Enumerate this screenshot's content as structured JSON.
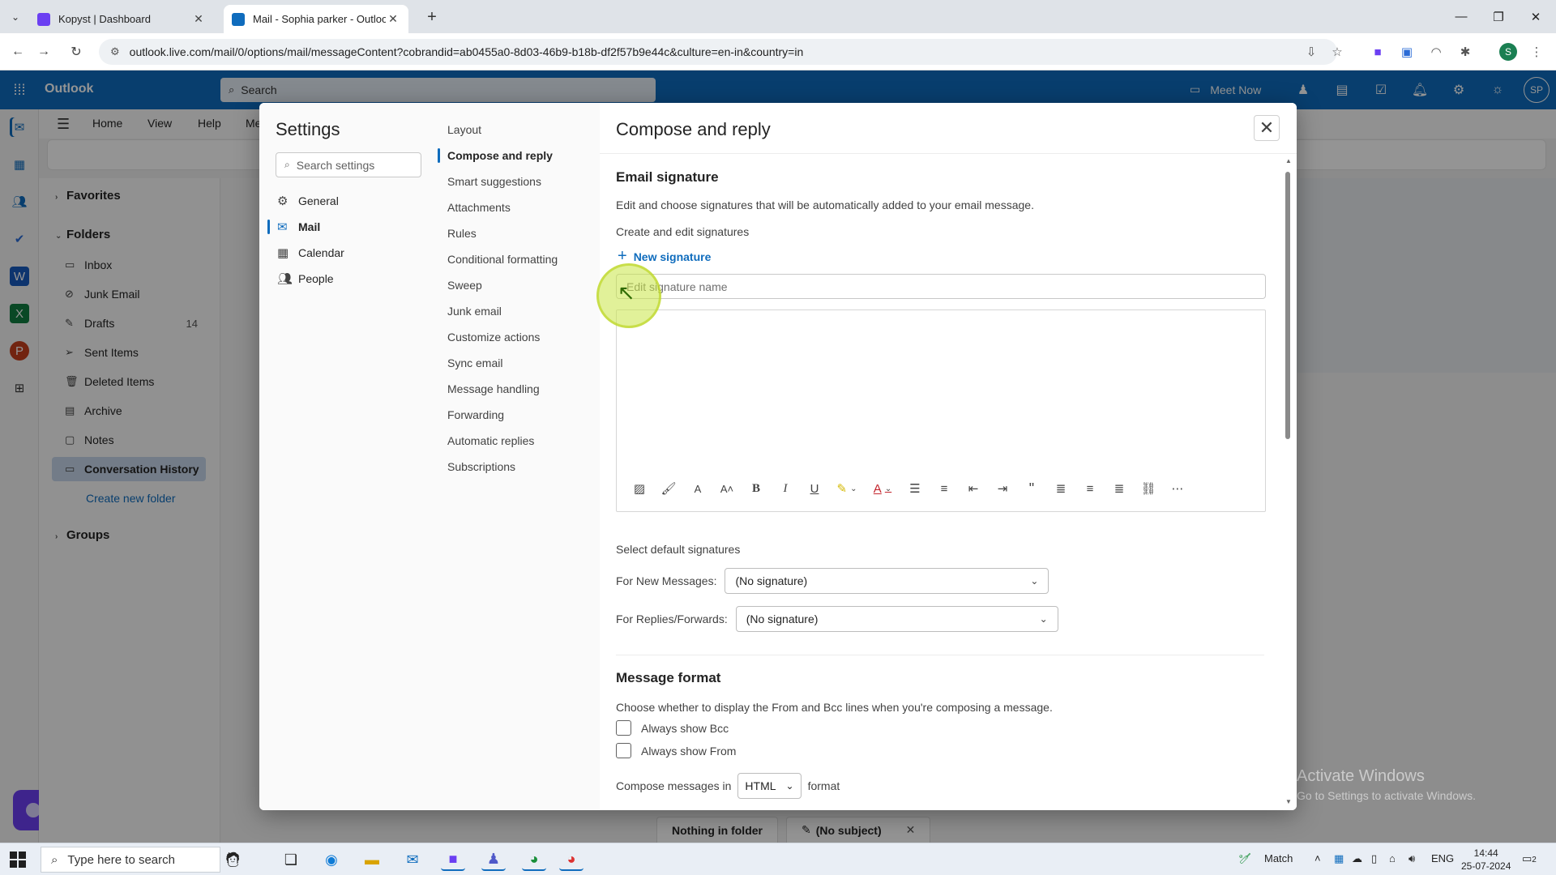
{
  "browser": {
    "tabs": [
      {
        "title": "Kopyst | Dashboard",
        "active": false
      },
      {
        "title": "Mail - Sophia parker - Outlook",
        "active": true
      }
    ],
    "url": "outlook.live.com/mail/0/options/mail/messageContent?cobrandid=ab0455a0-8d03-46b9-b18b-df2f57b9e44c&culture=en-in&country=in",
    "profile_initial": "S"
  },
  "outlook": {
    "brand": "Outlook",
    "search_placeholder": "Search",
    "meet_now": "Meet Now",
    "avatar_initials": "SP",
    "ribbon_tabs": [
      "Home",
      "View",
      "Help",
      "Me"
    ],
    "folders": {
      "favorites_label": "Favorites",
      "folders_label": "Folders",
      "groups_label": "Groups",
      "items": [
        {
          "label": "Inbox",
          "icon": "inbox-icon",
          "count": ""
        },
        {
          "label": "Junk Email",
          "icon": "junk-icon",
          "count": ""
        },
        {
          "label": "Drafts",
          "icon": "pencil-icon",
          "count": "14"
        },
        {
          "label": "Sent Items",
          "icon": "send-icon",
          "count": ""
        },
        {
          "label": "Deleted Items",
          "icon": "trash-icon",
          "count": ""
        },
        {
          "label": "Archive",
          "icon": "archive-icon",
          "count": ""
        },
        {
          "label": "Notes",
          "icon": "note-icon",
          "count": ""
        },
        {
          "label": "Conversation History",
          "icon": "folder-icon",
          "count": ""
        }
      ],
      "create_new_folder": "Create new folder"
    },
    "bottom_tabs": [
      "Nothing in folder",
      "(No subject)"
    ]
  },
  "settings": {
    "title": "Settings",
    "search_placeholder": "Search settings",
    "categories": [
      {
        "label": "General",
        "icon": "gear-icon"
      },
      {
        "label": "Mail",
        "icon": "mail-icon"
      },
      {
        "label": "Calendar",
        "icon": "calendar-icon"
      },
      {
        "label": "People",
        "icon": "people-icon"
      }
    ],
    "selected_category": "Mail",
    "subcategories": [
      "Layout",
      "Compose and reply",
      "Smart suggestions",
      "Attachments",
      "Rules",
      "Conditional formatting",
      "Sweep",
      "Junk email",
      "Customize actions",
      "Sync email",
      "Message handling",
      "Forwarding",
      "Automatic replies",
      "Subscriptions"
    ],
    "selected_subcategory": "Compose and reply"
  },
  "compose": {
    "title": "Compose and reply",
    "email_signature": {
      "heading": "Email signature",
      "description": "Edit and choose signatures that will be automatically added to your email message.",
      "create_edit": "Create and edit signatures",
      "new_signature": "New signature",
      "name_placeholder": "Edit signature name"
    },
    "defaults": {
      "heading": "Select default signatures",
      "new_messages_label": "For New Messages:",
      "new_messages_value": "(No signature)",
      "replies_label": "For Replies/Forwards:",
      "replies_value": "(No signature)"
    },
    "message_format": {
      "heading": "Message format",
      "description": "Choose whether to display the From and Bcc lines when you're composing a message.",
      "always_bcc": "Always show Bcc",
      "always_from": "Always show From",
      "compose_in": "Compose messages in",
      "format_value": "HTML",
      "format_suffix": "format"
    }
  },
  "watermark": {
    "line1": "Activate Windows",
    "line2": "Go to Settings to activate Windows."
  },
  "taskbar": {
    "search_placeholder": "Type here to search",
    "weather": "Match",
    "lang": "ENG",
    "time": "14:44",
    "date": "25-07-2024",
    "notifications": "2"
  }
}
